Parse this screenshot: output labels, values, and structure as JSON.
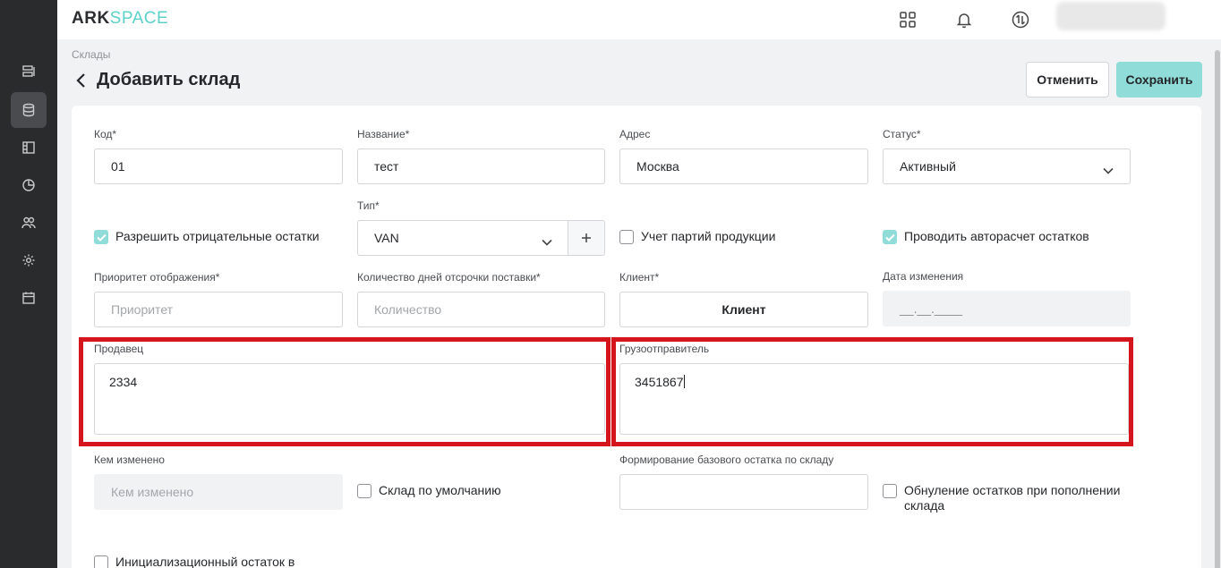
{
  "logo": {
    "part1": "ARK",
    "part2": "SPACE"
  },
  "breadcrumb": "Склады",
  "page_title": "Добавить склад",
  "buttons": {
    "cancel": "Отменить",
    "save": "Сохранить"
  },
  "form": {
    "code": {
      "label": "Код*",
      "value": "01"
    },
    "name": {
      "label": "Название*",
      "value": "тест"
    },
    "address": {
      "label": "Адрес",
      "value": "Москва"
    },
    "status": {
      "label": "Статус*",
      "value": "Активный"
    },
    "type": {
      "label": "Тип*",
      "value": "VAN"
    },
    "allow_negative": {
      "label": "Разрешить отрицательные остатки",
      "checked": true
    },
    "batch_accounting": {
      "label": "Учет партий продукции",
      "checked": false
    },
    "auto_calc": {
      "label": "Проводить авторасчет остатков",
      "checked": true
    },
    "priority": {
      "label": "Приоритет отображения*",
      "placeholder": "Приоритет"
    },
    "delay_days": {
      "label": "Количество дней отсрочки поставки*",
      "placeholder": "Количество"
    },
    "client": {
      "label": "Клиент*",
      "value": "Клиент"
    },
    "modified_date": {
      "label": "Дата изменения",
      "placeholder": "__.__.____"
    },
    "seller": {
      "label": "Продавец",
      "value": "2334"
    },
    "shipper": {
      "label": "Грузоотправитель",
      "value": "3451867"
    },
    "modified_by": {
      "label": "Кем изменено",
      "placeholder": "Кем изменено"
    },
    "default_warehouse": {
      "label": "Склад по умолчанию",
      "checked": false
    },
    "base_balance": {
      "label": "Формирование базового остатка по складу",
      "value": ""
    },
    "reset_on_replenish": {
      "label": "Обнуление остатков при пополнении склада",
      "checked": false
    },
    "init_balance": {
      "label": "Инициализационный остаток в",
      "checked": false
    }
  },
  "colors": {
    "accent": "#8fdcd8",
    "highlight": "#d4151b",
    "sidebar": "#2a2b2d"
  }
}
